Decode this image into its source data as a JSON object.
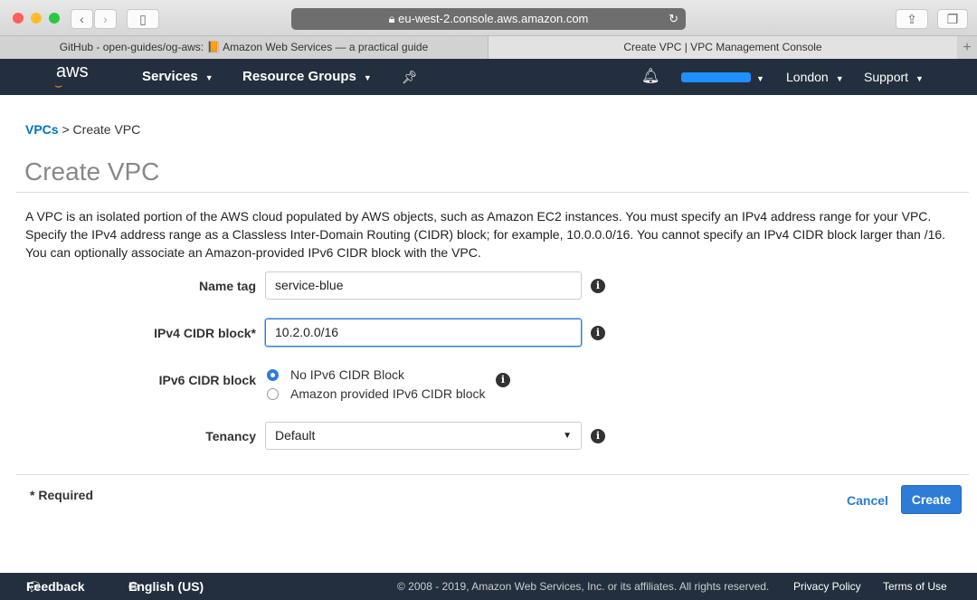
{
  "browser": {
    "url": "eu-west-2.console.aws.amazon.com",
    "tabs": [
      {
        "label": "GitHub - open-guides/og-aws: 📙 Amazon Web Services — a practical guide"
      },
      {
        "label": "Create VPC | VPC Management Console"
      }
    ]
  },
  "nav": {
    "logo": "aws",
    "services": "Services",
    "resource_groups": "Resource Groups",
    "region": "London",
    "support": "Support"
  },
  "breadcrumb": {
    "parent": "VPCs",
    "separator": " > ",
    "current": "Create VPC"
  },
  "page": {
    "title": "Create VPC",
    "description": "A VPC is an isolated portion of the AWS cloud populated by AWS objects, such as Amazon EC2 instances. You must specify an IPv4 address range for your VPC. Specify the IPv4 address range as a Classless Inter-Domain Routing (CIDR) block; for example, 10.0.0.0/16. You cannot specify an IPv4 CIDR block larger than /16. You can optionally associate an Amazon-provided IPv6 CIDR block with the VPC."
  },
  "form": {
    "name_tag": {
      "label": "Name tag",
      "value": "service-blue"
    },
    "ipv4": {
      "label": "IPv4 CIDR block*",
      "value": "10.2.0.0/16"
    },
    "ipv6": {
      "label": "IPv6 CIDR block",
      "options": [
        "No IPv6 CIDR Block",
        "Amazon provided IPv6 CIDR block"
      ],
      "selected": 0
    },
    "tenancy": {
      "label": "Tenancy",
      "value": "Default"
    }
  },
  "actions": {
    "required": "* Required",
    "cancel": "Cancel",
    "create": "Create"
  },
  "footer": {
    "feedback": "Feedback",
    "language": "English (US)",
    "copyright": "© 2008 - 2019, Amazon Web Services, Inc. or its affiliates. All rights reserved.",
    "privacy": "Privacy Policy",
    "terms": "Terms of Use"
  },
  "colors": {
    "nav_bg": "#232f3e",
    "accent": "#0073bb",
    "button": "#2d7cd6"
  }
}
